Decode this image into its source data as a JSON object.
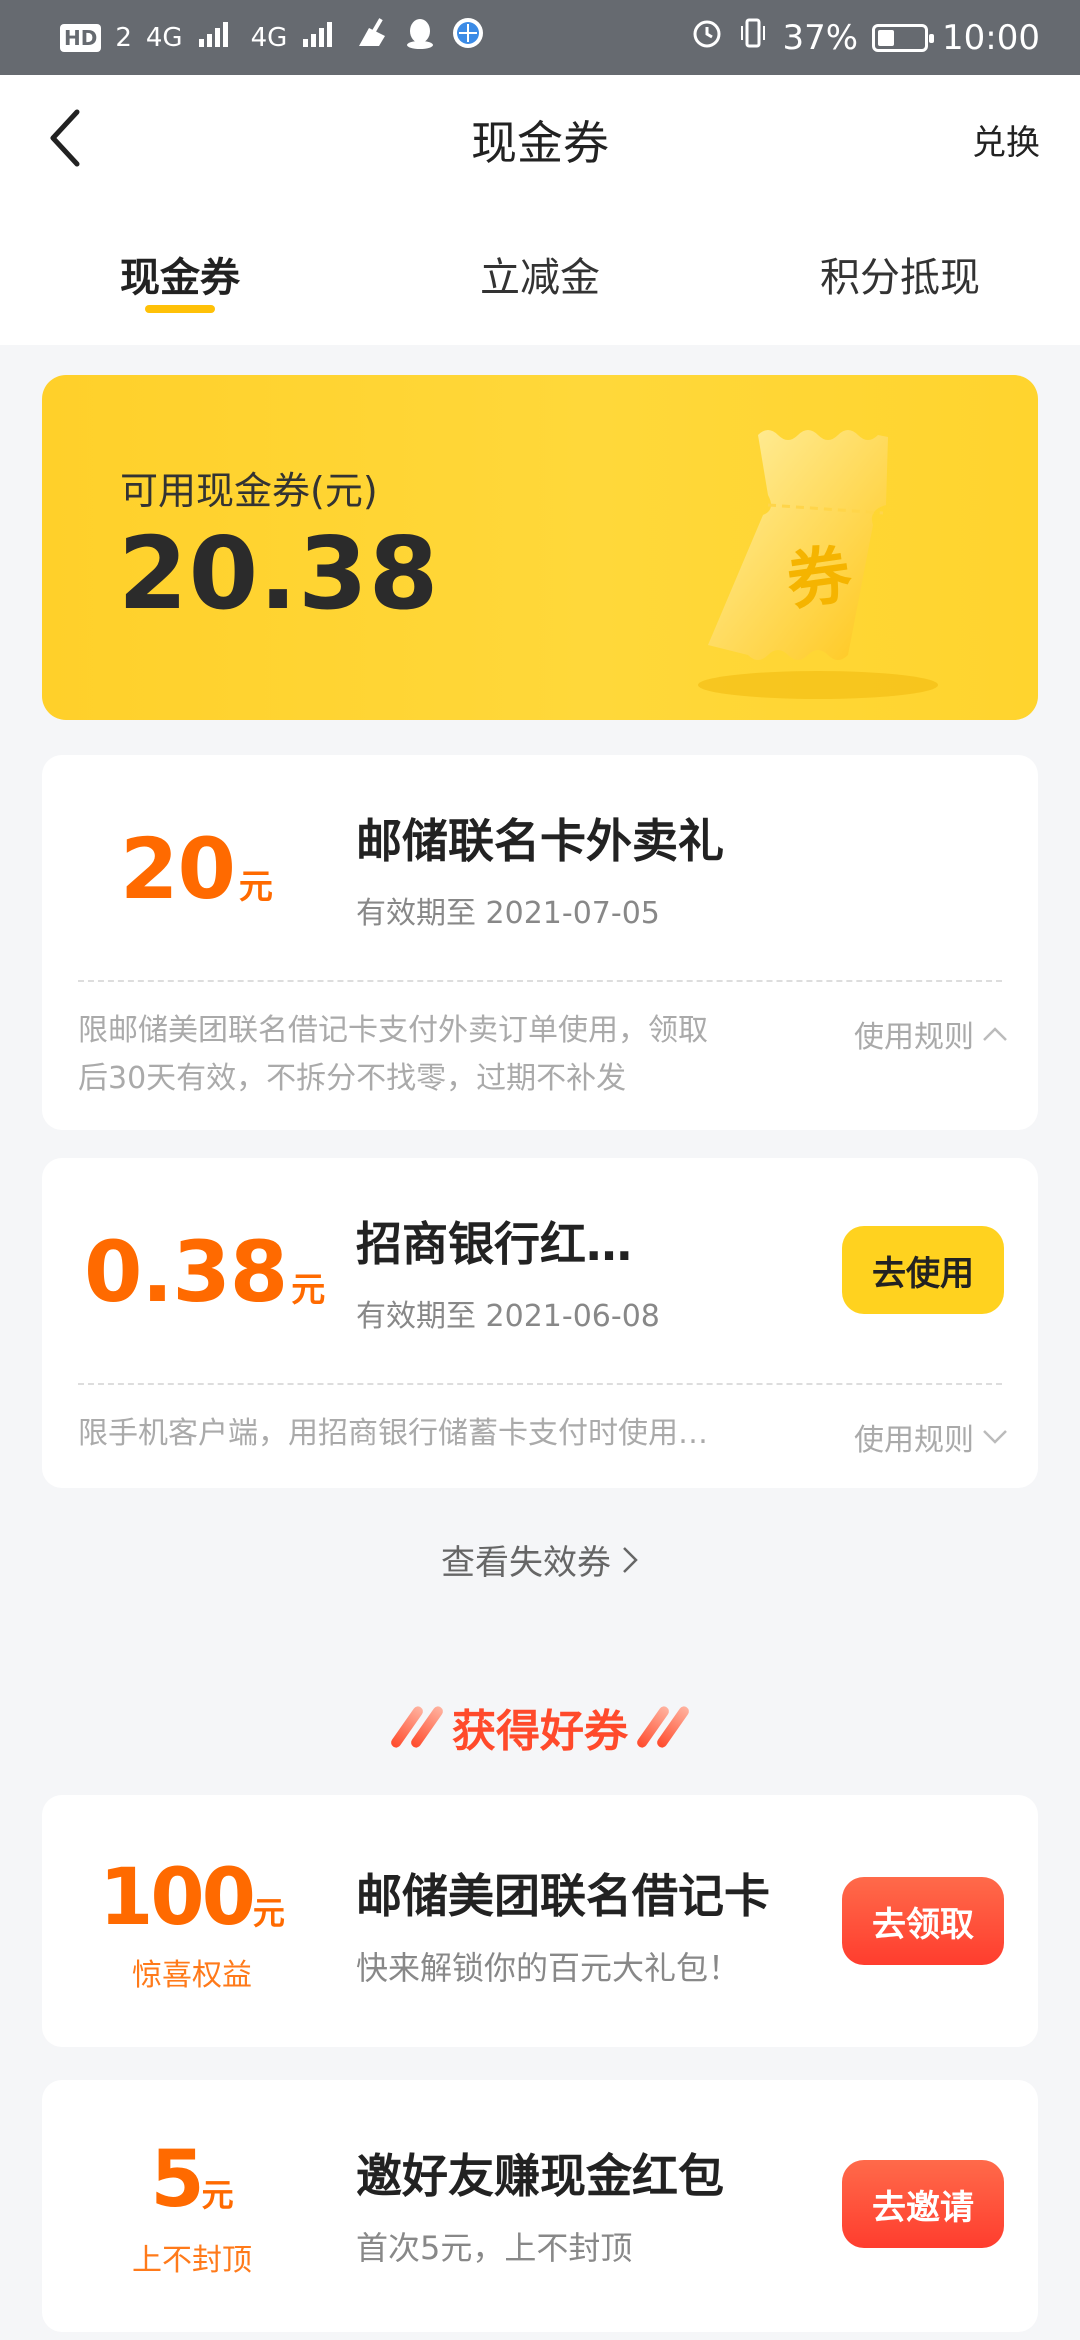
{
  "status_bar": {
    "hd_badge": "HD",
    "sim_slot": "2",
    "net1": "4G",
    "net2": "4G",
    "battery_text": "37%",
    "time": "10:00",
    "battery_level": 0.37
  },
  "nav": {
    "title": "现金券",
    "exchange": "兑换"
  },
  "tabs": [
    {
      "label": "现金券",
      "active": true
    },
    {
      "label": "立减金",
      "active": false
    },
    {
      "label": "积分抵现",
      "active": false
    }
  ],
  "hero": {
    "label": "可用现金券(元)",
    "amount": "20.38",
    "ticket_char": "券"
  },
  "coupons": [
    {
      "amount": "20",
      "unit": "元",
      "title": "邮储联名卡外卖礼",
      "validity": "有效期至 2021-07-05",
      "desc_line1": "限邮储美团联名借记卡支付外卖订单使用，领取",
      "desc_line2": "后30天有效，不拆分不找零，过期不补发",
      "rules": "使用规则",
      "rules_icon": "chevron-up-icon"
    },
    {
      "amount": "0.38",
      "unit": "元",
      "title": "招商银行红…",
      "validity": "有效期至 2021-06-08",
      "button": "去使用",
      "desc_line1": "限手机客户端，用招商银行储蓄卡支付时使用…",
      "rules": "使用规则",
      "rules_icon": "chevron-down-icon"
    }
  ],
  "expired_link": "查看失效券",
  "section_title": "获得好券",
  "promos": [
    {
      "amount": "100",
      "unit": "元",
      "subtitle": "惊喜权益",
      "title": "邮储美团联名借记卡",
      "desc": "快来解锁你的百元大礼包！",
      "button": "去领取"
    },
    {
      "amount": "5",
      "unit": "元",
      "subtitle": "上不封顶",
      "title": "邀好友赚现金红包",
      "desc": "首次5元，上不封顶",
      "button": "去邀请"
    }
  ],
  "colors": {
    "accent_yellow": "#ffd21f",
    "amount_orange": "#ff6a00",
    "cta_red": "#ff3d2e"
  }
}
